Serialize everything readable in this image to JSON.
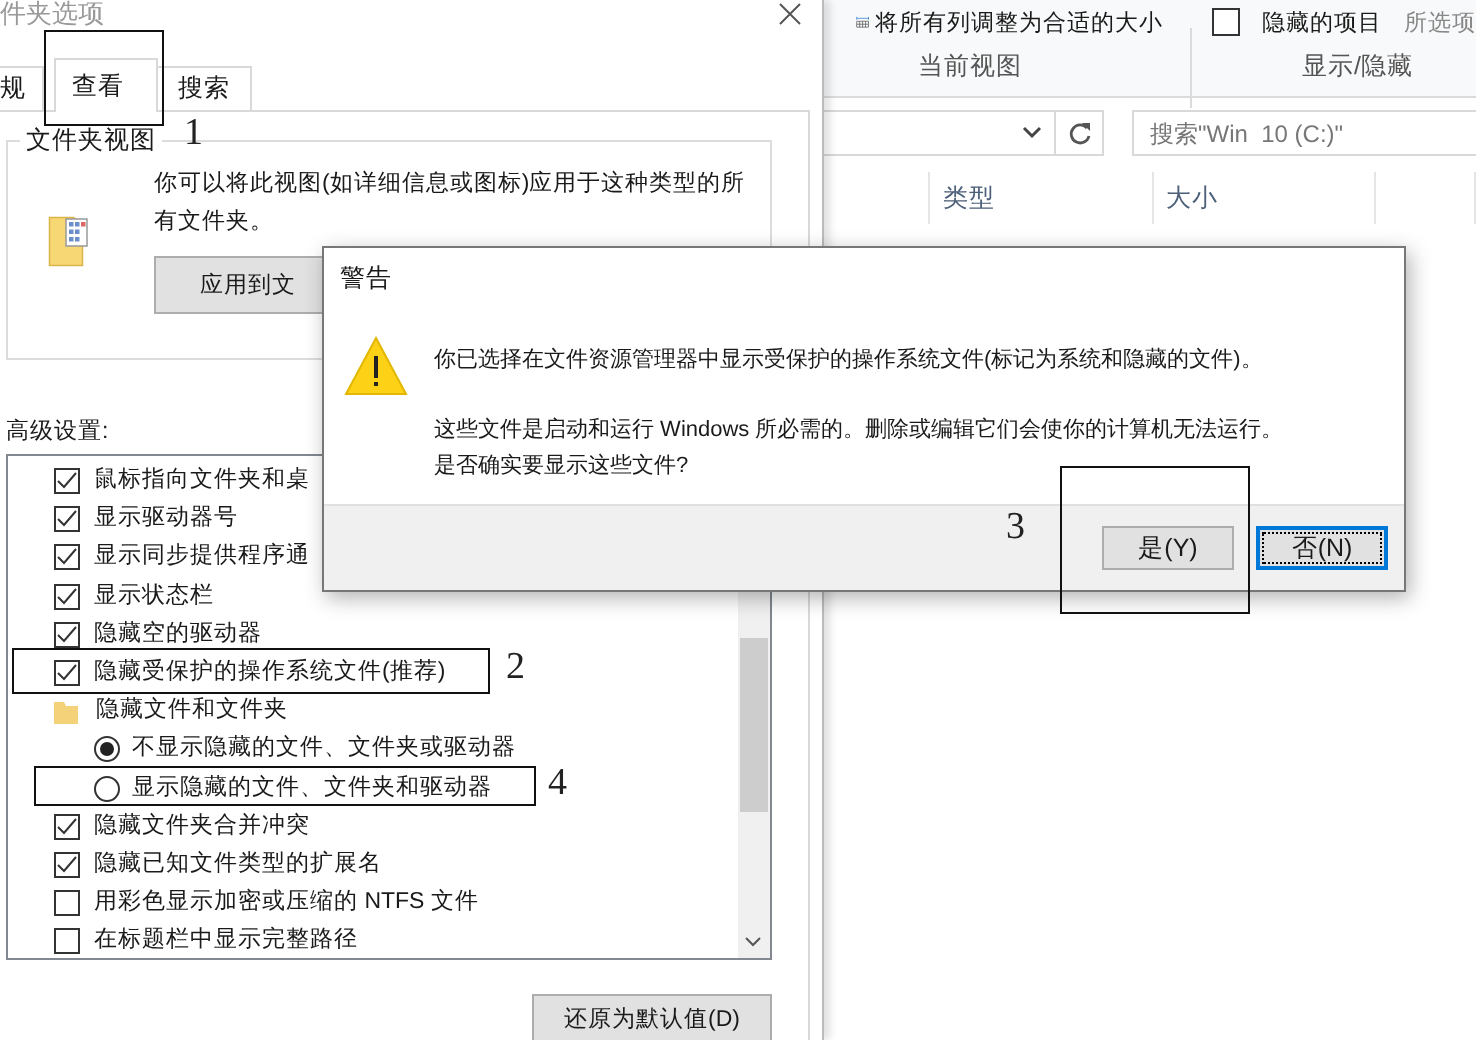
{
  "explorer": {
    "ribbon": {
      "fit_columns": "将所有列调整为合适的大小",
      "hidden_items": {
        "label": "隐藏的项目",
        "checked": false
      },
      "selected_items": "所选项",
      "groups": [
        "当前视图",
        "显示/隐藏"
      ]
    },
    "search": {
      "placeholder": "搜索\"Win  10 (C:)\""
    },
    "columns": [
      "类型",
      "大小"
    ]
  },
  "folder_options": {
    "title": "件夹选项",
    "tabs": [
      {
        "label": "规",
        "selected": false
      },
      {
        "label": "查看",
        "selected": true
      },
      {
        "label": "搜索",
        "selected": false
      }
    ],
    "folder_views": {
      "title": "文件夹视图",
      "text": "你可以将此视图(如详细信息或图标)应用于这种类型的所有文件夹。",
      "apply_button": "应用到文"
    },
    "advanced_label": "高级设置:",
    "settings": [
      {
        "kind": "checkbox",
        "label": "鼠标指向文件夹和桌",
        "checked": true
      },
      {
        "kind": "checkbox",
        "label": "显示驱动器号",
        "checked": true
      },
      {
        "kind": "checkbox",
        "label": "显示同步提供程序通",
        "checked": true
      },
      {
        "kind": "checkbox",
        "label": "显示状态栏",
        "checked": true
      },
      {
        "kind": "checkbox",
        "label": "隐藏空的驱动器",
        "checked": true
      },
      {
        "kind": "checkbox",
        "label": "隐藏受保护的操作系统文件(推荐)",
        "checked": true
      },
      {
        "kind": "folder",
        "label": "隐藏文件和文件夹"
      },
      {
        "kind": "radio",
        "label": "不显示隐藏的文件、文件夹或驱动器",
        "selected": true
      },
      {
        "kind": "radio",
        "label": "显示隐藏的文件、文件夹和驱动器",
        "selected": false
      },
      {
        "kind": "checkbox",
        "label": "隐藏文件夹合并冲突",
        "checked": true
      },
      {
        "kind": "checkbox",
        "label": "隐藏已知文件类型的扩展名",
        "checked": true
      },
      {
        "kind": "checkbox",
        "label": "用彩色显示加密或压缩的 NTFS 文件",
        "checked": false
      },
      {
        "kind": "checkbox",
        "label": "在标题栏中显示完整路径",
        "checked": false
      }
    ],
    "restore_button": "还原为默认值(D)"
  },
  "warning_dialog": {
    "title": "警告",
    "message": "你已选择在文件资源管理器中显示受保护的操作系统文件(标记为系统和隐藏的文件)。",
    "details": [
      "这些文件是启动和运行 Windows 所必需的。删除或编辑它们会使你的计算机无法运行。",
      "是否确实要显示这些文件?"
    ],
    "buttons": [
      {
        "label": "是(Y)",
        "focused": false
      },
      {
        "label": "否(N)",
        "focused": true
      }
    ]
  },
  "annotations": [
    {
      "label": "1"
    },
    {
      "label": "2"
    },
    {
      "label": "3"
    },
    {
      "label": "4"
    }
  ]
}
